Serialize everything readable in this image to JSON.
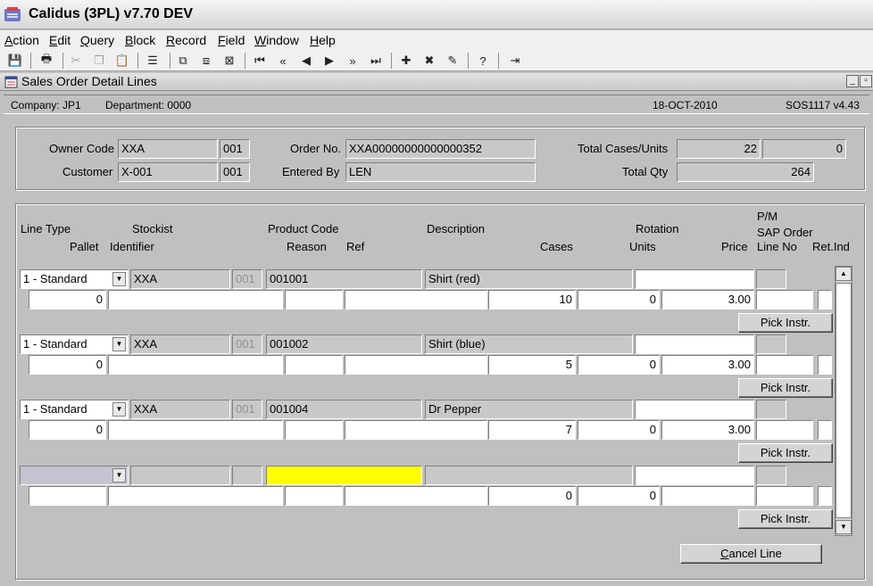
{
  "window": {
    "title": "Calidus (3PL) v7.70 DEV"
  },
  "menu": [
    {
      "label": "Action",
      "u": "A",
      "rest": "ction"
    },
    {
      "label": "Edit",
      "u": "E",
      "rest": "dit"
    },
    {
      "label": "Query",
      "u": "Q",
      "rest": "uery"
    },
    {
      "label": "Block",
      "u": "B",
      "rest": "lock"
    },
    {
      "label": "Record",
      "u": "R",
      "rest": "ecord"
    },
    {
      "label": "Field",
      "u": "F",
      "rest": "ield"
    },
    {
      "label": "Window",
      "u": "W",
      "rest": "indow"
    },
    {
      "label": "Help",
      "u": "H",
      "rest": "elp"
    }
  ],
  "toolbar_icons": [
    "save-icon",
    "print-icon",
    "cut-icon",
    "copy-icon",
    "paste-icon",
    "list-icon",
    "query-enter-icon",
    "query-execute-icon",
    "query-cancel-icon",
    "first-record-icon",
    "previous-set-icon",
    "previous-record-icon",
    "next-record-icon",
    "next-set-icon",
    "last-record-icon",
    "insert-record-icon",
    "delete-record-icon",
    "clear-record-icon",
    "help-icon",
    "exit-icon"
  ],
  "subwindow": {
    "title": "Sales Order Detail Lines"
  },
  "info": {
    "company": "Company:  JP1",
    "department": "Department:  0000",
    "date": "18-OCT-2010",
    "screen": "SOS1117  v4.43"
  },
  "header": {
    "owner_code_label": "Owner Code",
    "owner_code": "XXA",
    "owner_code_suffix": "001",
    "customer_label": "Customer",
    "customer": "X-001",
    "customer_suffix": "001",
    "order_no_label": "Order No.",
    "order_no": "XXA00000000000000352",
    "entered_by_label": "Entered By",
    "entered_by": "LEN",
    "total_cases_label": "Total Cases/Units",
    "total_cases": "22",
    "total_units": "0",
    "total_qty_label": "Total Qty",
    "total_qty": "264"
  },
  "columns": {
    "line_type": "Line Type",
    "stockist": "Stockist",
    "product_code": "Product Code",
    "description": "Description",
    "rotation": "Rotation",
    "pm": "P/M",
    "sap_order": "SAP Order",
    "pallet": "Pallet",
    "identifier": "Identifier",
    "reason": "Reason",
    "ref": "Ref",
    "cases": "Cases",
    "units": "Units",
    "price": "Price",
    "line_no": "Line No",
    "ret_ind": "Ret.Ind"
  },
  "lines": [
    {
      "line_type": "1 - Standard",
      "stockist": "XXA",
      "stockist_suffix": "001",
      "product_code": "001001",
      "description": "Shirt (red)",
      "pallet": "0",
      "cases": "10",
      "units": "0",
      "price": "3.00",
      "pick_label": "Pick Instr."
    },
    {
      "line_type": "1 - Standard",
      "stockist": "XXA",
      "stockist_suffix": "001",
      "product_code": "001002",
      "description": "Shirt (blue)",
      "pallet": "0",
      "cases": "5",
      "units": "0",
      "price": "3.00",
      "pick_label": "Pick Instr."
    },
    {
      "line_type": "1 - Standard",
      "stockist": "XXA",
      "stockist_suffix": "001",
      "product_code": "001004",
      "description": "Dr Pepper",
      "pallet": "0",
      "cases": "7",
      "units": "0",
      "price": "3.00",
      "pick_label": "Pick Instr."
    },
    {
      "line_type": "",
      "stockist": "",
      "stockist_suffix": "",
      "product_code": "",
      "description": "",
      "pallet": "",
      "cases": "0",
      "units": "0",
      "price": "",
      "pick_label": "Pick Instr."
    }
  ],
  "cancel_button": {
    "u": "C",
    "rest": "ancel Line"
  },
  "colors": {
    "active_field": "#ffff00",
    "background": "#c0c0c0"
  }
}
